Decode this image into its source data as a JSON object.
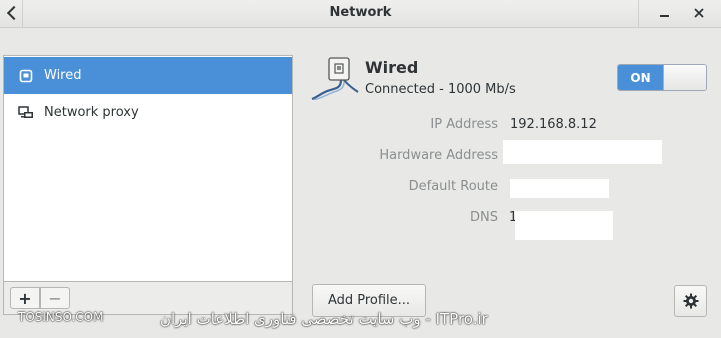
{
  "window": {
    "title": "Network"
  },
  "sidebar": {
    "items": [
      {
        "label": "Wired",
        "icon": "ethernet-icon",
        "selected": true
      },
      {
        "label": "Network proxy",
        "icon": "network-proxy-icon",
        "selected": false
      }
    ],
    "add_label": "+",
    "remove_label": "−"
  },
  "device": {
    "name": "Wired",
    "status": "Connected - 1000 Mb/s",
    "switch_label": "ON",
    "switch_on": true,
    "properties": [
      {
        "label": "IP Address",
        "value": "192.168.8.12"
      },
      {
        "label": "Hardware Address",
        "value": ""
      },
      {
        "label": "Default Route",
        "value": ""
      },
      {
        "label": "DNS",
        "value": "1"
      }
    ]
  },
  "actions": {
    "add_profile": "Add Profile..."
  },
  "watermark": {
    "left": "TOSINSO.COM",
    "right": "ITPro.ir - وب سایت تخصصی فناوری اطلاعات ایران"
  },
  "colors": {
    "accent": "#4a90d9",
    "background": "#e8e8e7"
  }
}
